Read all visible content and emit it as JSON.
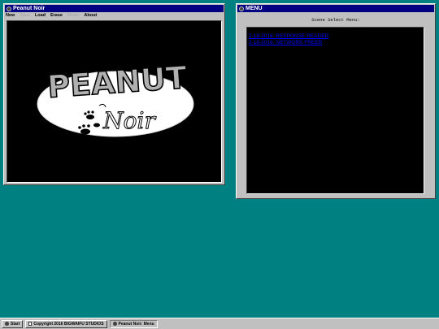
{
  "game_window": {
    "title": "Peanut Noir",
    "menu": [
      {
        "label": "New",
        "enabled": true
      },
      {
        "label": "Save",
        "enabled": false
      },
      {
        "label": "Load",
        "enabled": true
      },
      {
        "label": "Erase",
        "enabled": true
      },
      {
        "label": "Music",
        "enabled": false
      },
      {
        "label": "About",
        "enabled": true
      }
    ],
    "logo": {
      "word1": "PEANUT",
      "word2": "Noir"
    }
  },
  "menu_window": {
    "title": "MENU",
    "heading": "Scene Select Menu:",
    "items": [
      "2-18-2016: RESPONSE READER",
      "2-18-2016: NETWORK FREER"
    ]
  },
  "taskbar": {
    "start_label": "Start",
    "copyright": "Copyright 2016 BIGWAIFU STUDIOS",
    "task": "Peanut Noir: Menu"
  }
}
